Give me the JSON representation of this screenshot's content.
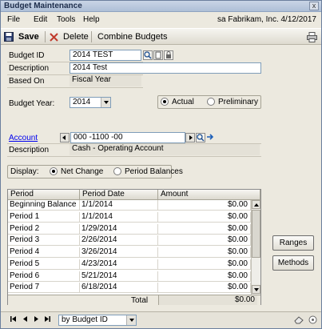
{
  "window": {
    "title": "Budget Maintenance",
    "close_glyph": "x"
  },
  "menu": {
    "items": [
      "File",
      "Edit",
      "Tools",
      "Help"
    ],
    "company": "sa  Fabrikam, Inc.  4/12/2017"
  },
  "toolbar": {
    "save_label": "Save",
    "delete_label": "Delete",
    "combine_label": "Combine Budgets"
  },
  "form": {
    "budget_id_label": "Budget ID",
    "budget_id_value": "2014 TEST",
    "description_label": "Description",
    "description_value": "2014 Test",
    "based_on_label": "Based On",
    "based_on_value": "Fiscal Year",
    "budget_year_label": "Budget Year:",
    "budget_year_value": "2014",
    "actual_label": "Actual",
    "preliminary_label": "Preliminary",
    "account_label": "Account",
    "account_value": "000 -1100 -00",
    "account_desc_label": "Description",
    "account_desc_value": "Cash - Operating Account",
    "display_label": "Display:",
    "net_change_label": "Net Change",
    "period_balances_label": "Period Balances"
  },
  "grid": {
    "headers": [
      "Period",
      "Period Date",
      "Amount"
    ],
    "rows": [
      [
        "Beginning Balance",
        "1/1/2014",
        "$0.00"
      ],
      [
        "Period 1",
        "1/1/2014",
        "$0.00"
      ],
      [
        "Period 2",
        "1/29/2014",
        "$0.00"
      ],
      [
        "Period 3",
        "2/26/2014",
        "$0.00"
      ],
      [
        "Period 4",
        "3/26/2014",
        "$0.00"
      ],
      [
        "Period 5",
        "4/23/2014",
        "$0.00"
      ],
      [
        "Period 6",
        "5/21/2014",
        "$0.00"
      ],
      [
        "Period 7",
        "6/18/2014",
        "$0.00"
      ]
    ],
    "total_label": "Total",
    "total_value": "$0.00"
  },
  "side_buttons": {
    "ranges": "Ranges",
    "methods": "Methods"
  },
  "status": {
    "sort_value": "by Budget ID"
  },
  "colors": {
    "accent": "#0000ee",
    "titlebar": "#aebfd7",
    "window_bg": "#ece9df"
  },
  "icons": [
    "save-icon",
    "delete-icon",
    "print-icon",
    "lookup-icon",
    "note-icon",
    "lock-icon",
    "expand-arrow-icon",
    "first-icon",
    "previous-icon",
    "next-icon",
    "last-icon",
    "eraser-icon",
    "help-icon"
  ]
}
